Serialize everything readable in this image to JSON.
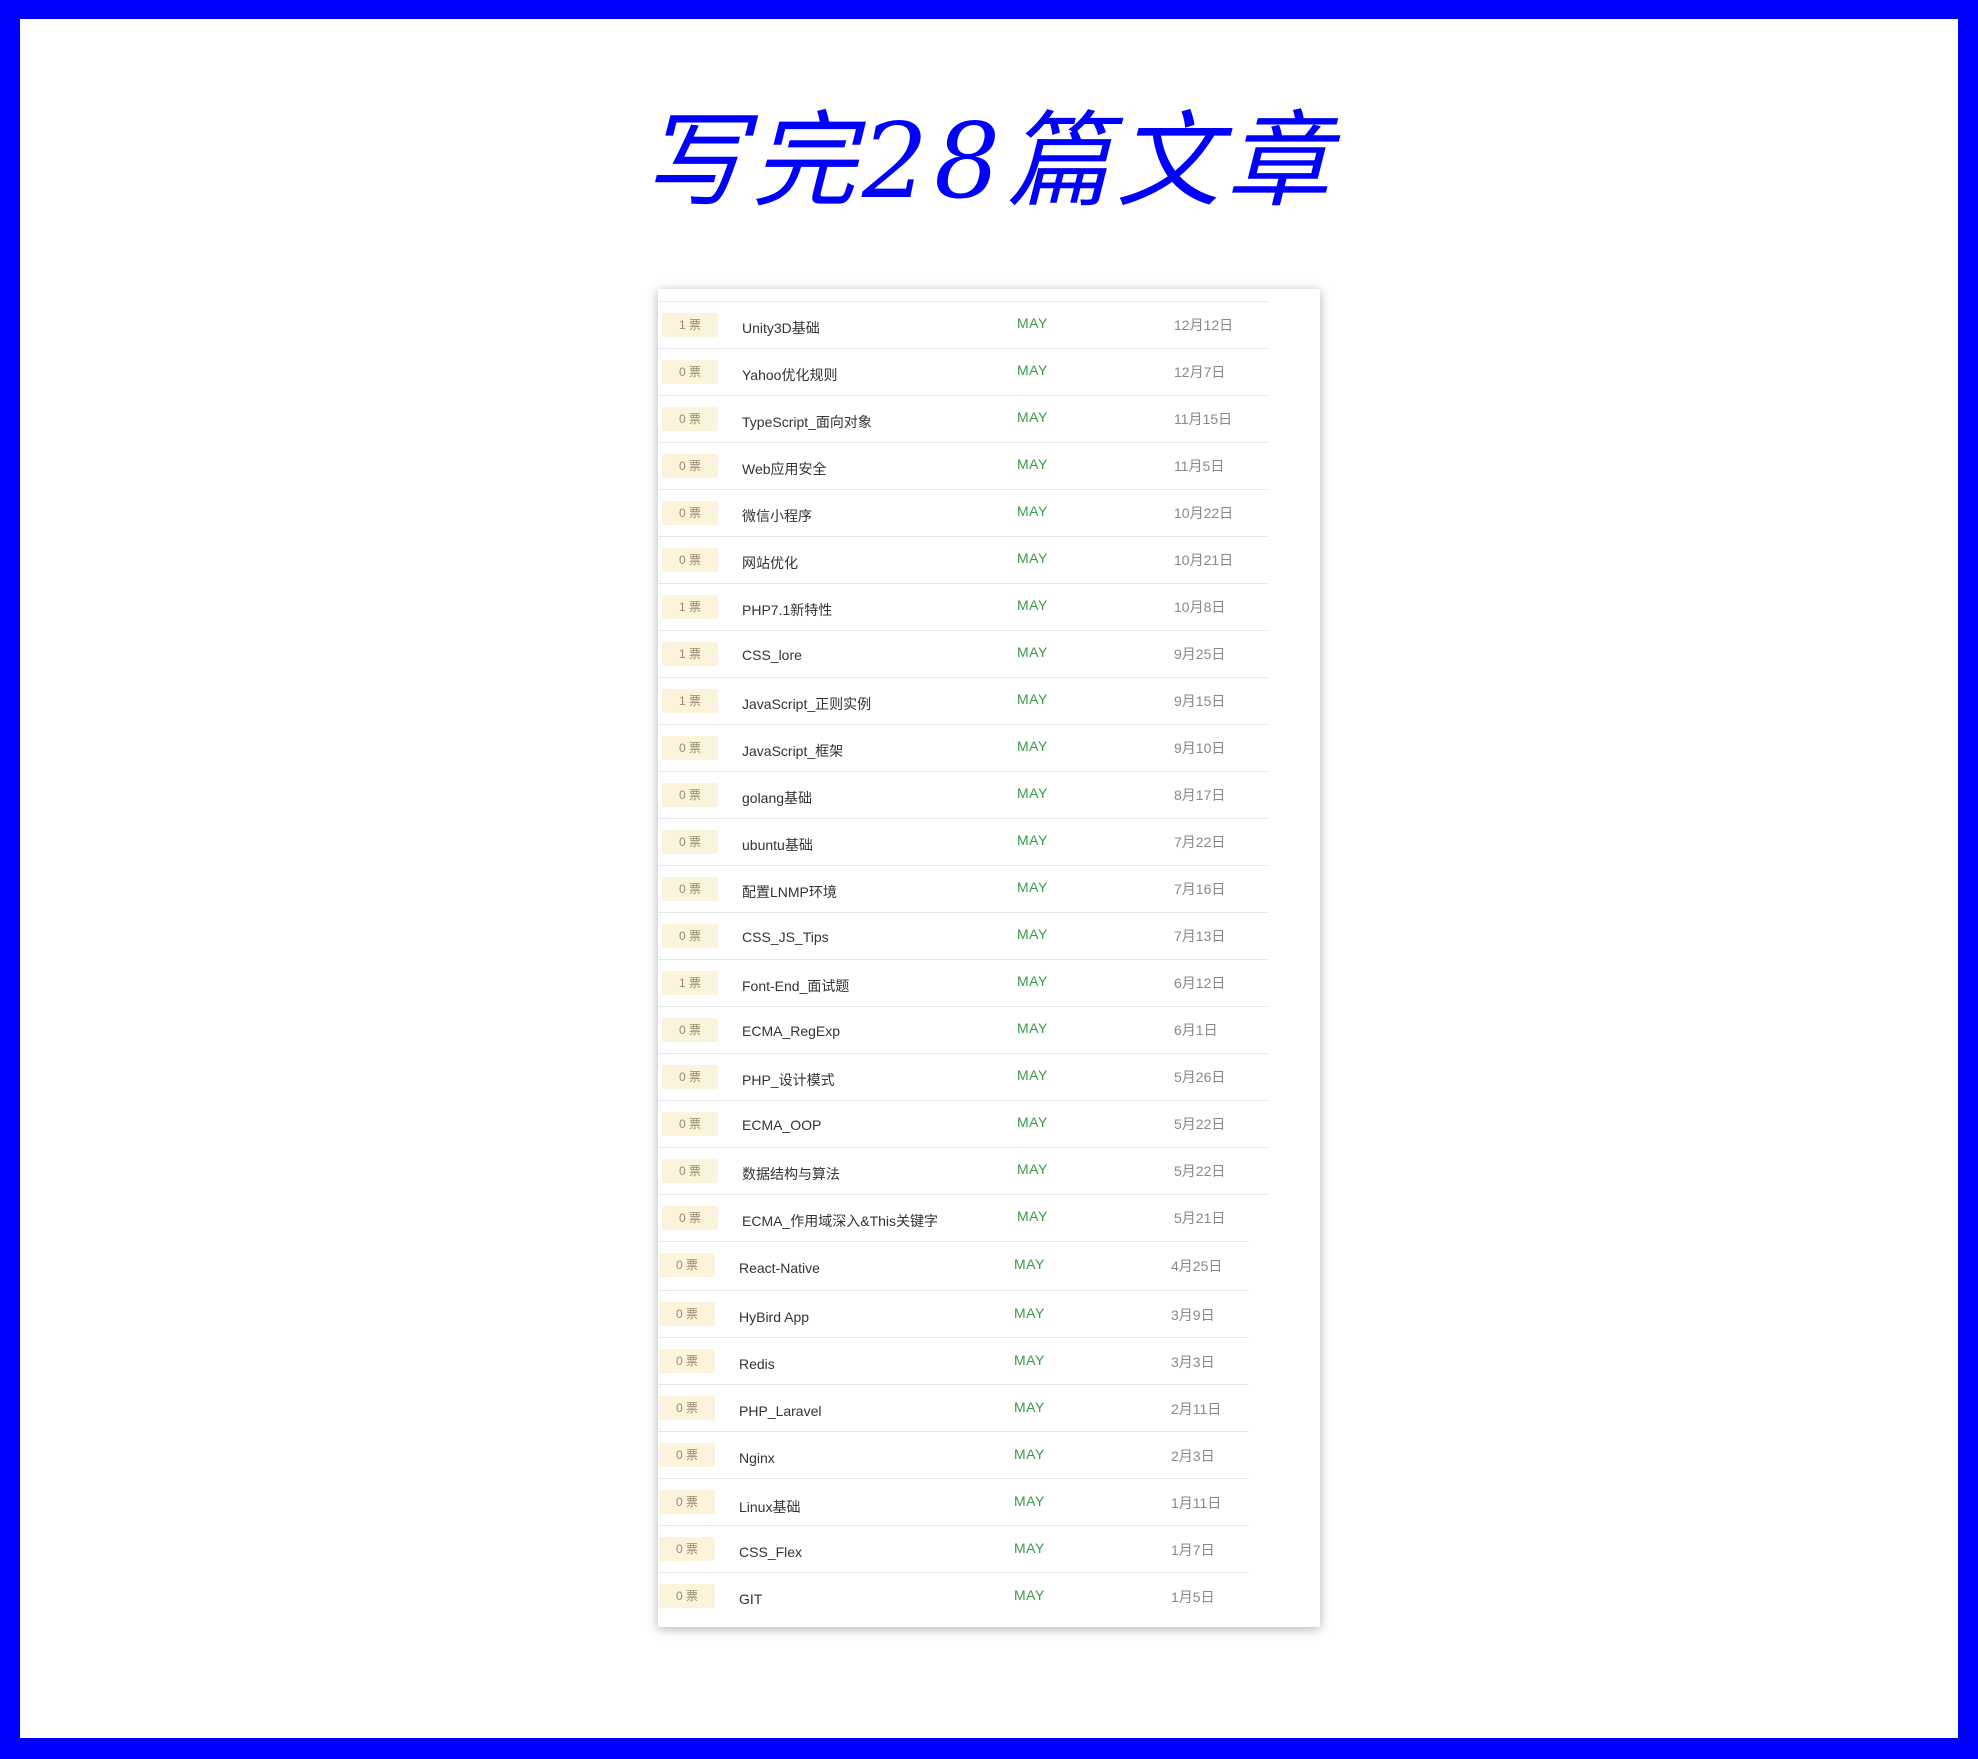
{
  "page": {
    "title": "写完28篇文章"
  },
  "colors": {
    "frame": "#0000ff",
    "background": "#ffffff",
    "author_green": "#3a9a4a",
    "vote_badge_bg": "#fbf3dc"
  },
  "articles": [
    {
      "votes": "1 票",
      "title": "Unity3D基础",
      "author": "MAY",
      "date": "12月12日"
    },
    {
      "votes": "0 票",
      "title": "Yahoo优化规则",
      "author": "MAY",
      "date": "12月7日"
    },
    {
      "votes": "0 票",
      "title": "TypeScript_面向对象",
      "author": "MAY",
      "date": "11月15日"
    },
    {
      "votes": "0 票",
      "title": "Web应用安全",
      "author": "MAY",
      "date": "11月5日"
    },
    {
      "votes": "0 票",
      "title": "微信小程序",
      "author": "MAY",
      "date": "10月22日"
    },
    {
      "votes": "0 票",
      "title": "网站优化",
      "author": "MAY",
      "date": "10月21日"
    },
    {
      "votes": "1 票",
      "title": "PHP7.1新特性",
      "author": "MAY",
      "date": "10月8日"
    },
    {
      "votes": "1 票",
      "title": "CSS_lore",
      "author": "MAY",
      "date": "9月25日"
    },
    {
      "votes": "1 票",
      "title": "JavaScript_正则实例",
      "author": "MAY",
      "date": "9月15日"
    },
    {
      "votes": "0 票",
      "title": "JavaScript_框架",
      "author": "MAY",
      "date": "9月10日"
    },
    {
      "votes": "0 票",
      "title": "golang基础",
      "author": "MAY",
      "date": "8月17日"
    },
    {
      "votes": "0 票",
      "title": "ubuntu基础",
      "author": "MAY",
      "date": "7月22日"
    },
    {
      "votes": "0 票",
      "title": "配置LNMP环境",
      "author": "MAY",
      "date": "7月16日"
    },
    {
      "votes": "0 票",
      "title": "CSS_JS_Tips",
      "author": "MAY",
      "date": "7月13日"
    },
    {
      "votes": "1 票",
      "title": "Font-End_面试题",
      "author": "MAY",
      "date": "6月12日"
    },
    {
      "votes": "0 票",
      "title": "ECMA_RegExp",
      "author": "MAY",
      "date": "6月1日"
    },
    {
      "votes": "0 票",
      "title": "PHP_设计模式",
      "author": "MAY",
      "date": "5月26日"
    },
    {
      "votes": "0 票",
      "title": "ECMA_OOP",
      "author": "MAY",
      "date": "5月22日"
    },
    {
      "votes": "0 票",
      "title": "数据结构与算法",
      "author": "MAY",
      "date": "5月22日"
    },
    {
      "votes": "0 票",
      "title": "ECMA_作用域深入&This关键字",
      "author": "MAY",
      "date": "5月21日"
    },
    {
      "votes": "0 票",
      "title": "React-Native",
      "author": "MAY",
      "date": "4月25日"
    },
    {
      "votes": "0 票",
      "title": "HyBird App",
      "author": "MAY",
      "date": "3月9日"
    },
    {
      "votes": "0 票",
      "title": "Redis",
      "author": "MAY",
      "date": "3月3日"
    },
    {
      "votes": "0 票",
      "title": "PHP_Laravel",
      "author": "MAY",
      "date": "2月11日"
    },
    {
      "votes": "0 票",
      "title": "Nginx",
      "author": "MAY",
      "date": "2月3日"
    },
    {
      "votes": "0 票",
      "title": "Linux基础",
      "author": "MAY",
      "date": "1月11日"
    },
    {
      "votes": "0 票",
      "title": "CSS_Flex",
      "author": "MAY",
      "date": "1月7日"
    },
    {
      "votes": "0 票",
      "title": "GIT",
      "author": "MAY",
      "date": "1月5日"
    }
  ]
}
